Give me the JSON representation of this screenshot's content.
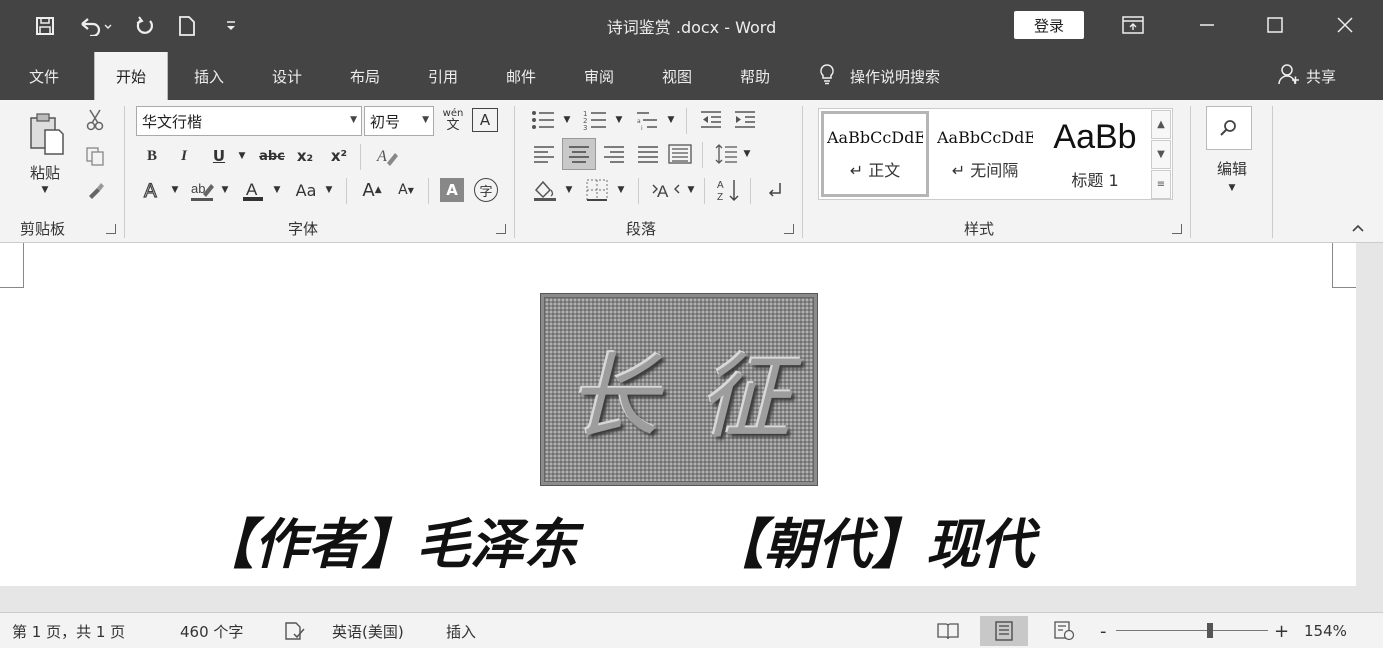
{
  "titlebar": {
    "doc_title": "诗词鉴赏 .docx - Word",
    "login": "登录"
  },
  "tabs": {
    "file": "文件",
    "home": "开始",
    "insert": "插入",
    "design": "设计",
    "layout": "布局",
    "references": "引用",
    "mailings": "邮件",
    "review": "审阅",
    "view": "视图",
    "help": "帮助",
    "tell_me": "操作说明搜索",
    "share": "共享"
  },
  "ribbon": {
    "clipboard": {
      "paste": "粘贴",
      "label": "剪贴板"
    },
    "font": {
      "name": "华文行楷",
      "size": "初号",
      "bold": "B",
      "italic": "I",
      "underline": "U",
      "strike": "abc",
      "subscript": "x₂",
      "superscript": "x²",
      "case": "Aa",
      "grow": "A",
      "shrink": "A",
      "pinyin": "wén",
      "pinyin_char": "文",
      "enclose": "字",
      "label": "字体"
    },
    "paragraph": {
      "label": "段落"
    },
    "styles": {
      "items": [
        {
          "sample": "AaBbCcDdEe",
          "name": "↵ 正文"
        },
        {
          "sample": "AaBbCcDdEe",
          "name": "↵ 无间隔"
        },
        {
          "sample": "AaBb",
          "name": "标题 1"
        }
      ],
      "label": "样式"
    },
    "editing": {
      "label": "编辑"
    }
  },
  "document": {
    "wordart_chars": [
      "长",
      "征"
    ],
    "author_label": "【作者】",
    "author": "毛泽东",
    "dynasty_label": "【朝代】",
    "dynasty": "现代"
  },
  "statusbar": {
    "page": "第 1 页，共 1 页",
    "words": "460 个字",
    "language": "英语(美国)",
    "mode": "插入",
    "zoom_minus": "-",
    "zoom_plus": "+",
    "zoom": "154%",
    "zoom_level": 0.62
  },
  "colors": {
    "titlebar": "#444444",
    "ribbon": "#f3f3f3"
  }
}
